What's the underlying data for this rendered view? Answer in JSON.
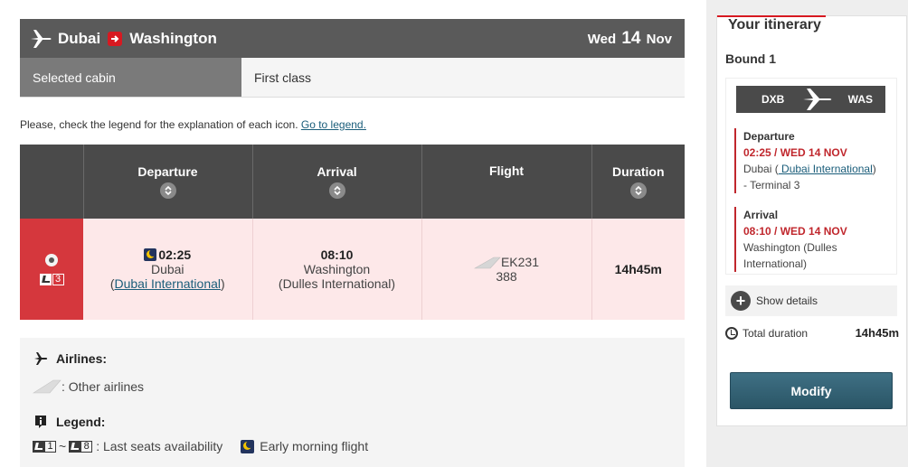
{
  "route": {
    "origin": "Dubai",
    "destination": "Washington",
    "date_weekday": "Wed",
    "date_day": "14",
    "date_month": "Nov"
  },
  "cabin": {
    "label": "Selected cabin",
    "value": "First class"
  },
  "legend_note": {
    "text": "Please, check the legend for the explanation of each icon. ",
    "link": "Go to legend."
  },
  "table": {
    "headers": [
      "Departure",
      "Arrival",
      "Flight",
      "Duration"
    ],
    "row": {
      "seats_left": "3",
      "departure_time": "02:25",
      "departure_city": "Dubai",
      "departure_airport": "Dubai International",
      "arrival_time": "08:10",
      "arrival_city": "Washington",
      "arrival_airport": "(Dulles International)",
      "flight_number": "EK231",
      "aircraft": "388",
      "duration": "14h45m"
    }
  },
  "legend": {
    "airlines_heading": "Airlines:",
    "other_airlines": ": Other airlines",
    "legend_heading": "Legend:",
    "seat_min": "1",
    "seat_max": "8",
    "tilde": "~",
    "last_seats": ": Last seats availability",
    "early_morning": "Early morning flight"
  },
  "itinerary": {
    "title": "Your itinerary",
    "bound": "Bound 1",
    "from_code": "DXB",
    "to_code": "WAS",
    "departure": {
      "heading": "Departure",
      "time": "02:25 / WED 14 NOV",
      "city": "Dubai (",
      "airport": " Dubai International",
      "close": ")",
      "terminal": "- Terminal  3"
    },
    "arrival": {
      "heading": "Arrival",
      "time": "08:10 / WED 14 NOV",
      "place": "Washington (Dulles International)"
    },
    "show_details": "Show details",
    "total_label": "Total duration",
    "total_value": "14h45m",
    "modify": "Modify"
  },
  "colors": {
    "accent_red": "#d71921",
    "row_pink": "#fde8e9",
    "button_teal": "#2f5f72"
  }
}
